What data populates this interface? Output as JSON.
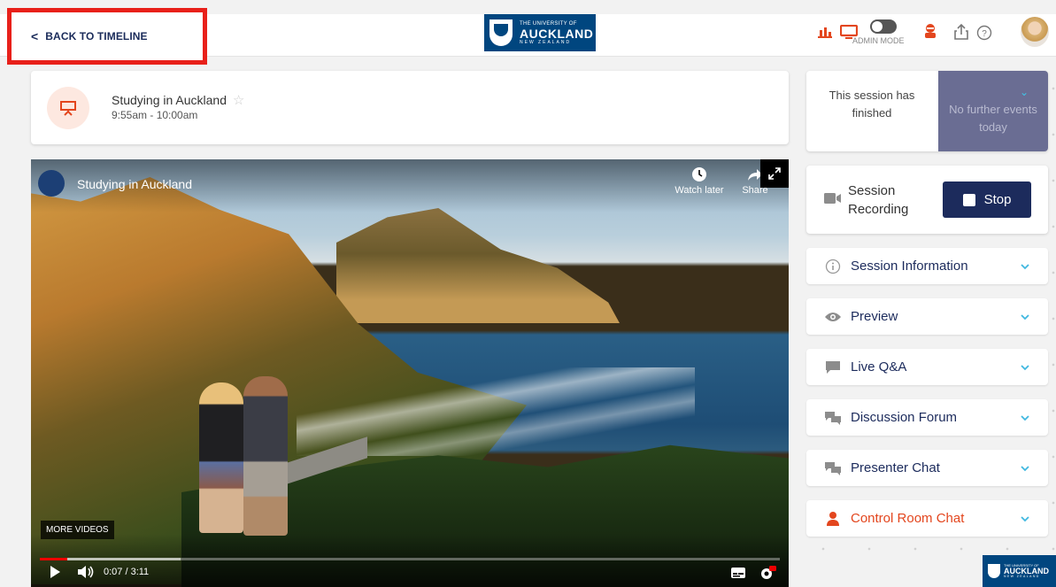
{
  "header": {
    "back_label": "BACK TO TIMELINE",
    "logo": {
      "line1": "THE UNIVERSITY OF",
      "line2": "AUCKLAND",
      "line3": "NEW ZEALAND"
    },
    "admin_mode_label": "ADMIN MODE"
  },
  "session": {
    "title": "Studying in Auckland",
    "time": "9:55am - 10:00am"
  },
  "video": {
    "title": "Studying in Auckland",
    "watch_later": "Watch later",
    "share": "Share",
    "more_videos": "MORE VIDEOS",
    "time": "0:07 / 3:11",
    "progress_fraction": 0.037,
    "buffered_fraction": 0.19
  },
  "status": {
    "finished": "This session has finished",
    "next": "No further events today"
  },
  "recording": {
    "label": "Session Recording",
    "stop_label": "Stop"
  },
  "panels": [
    {
      "label": "Session Information",
      "icon": "info-icon"
    },
    {
      "label": "Preview",
      "icon": "eye-icon"
    },
    {
      "label": "Live Q&A",
      "icon": "chat-bubble-icon"
    },
    {
      "label": "Discussion Forum",
      "icon": "chat-bubbles-icon"
    },
    {
      "label": "Presenter Chat",
      "icon": "chat-bubbles-icon"
    },
    {
      "label": "Control Room Chat",
      "icon": "person-icon"
    }
  ],
  "colors": {
    "accent_navy": "#1c2b5c",
    "brand_blue": "#00467f",
    "alert_red": "#e3461e",
    "highlight_border": "#e8201a"
  }
}
